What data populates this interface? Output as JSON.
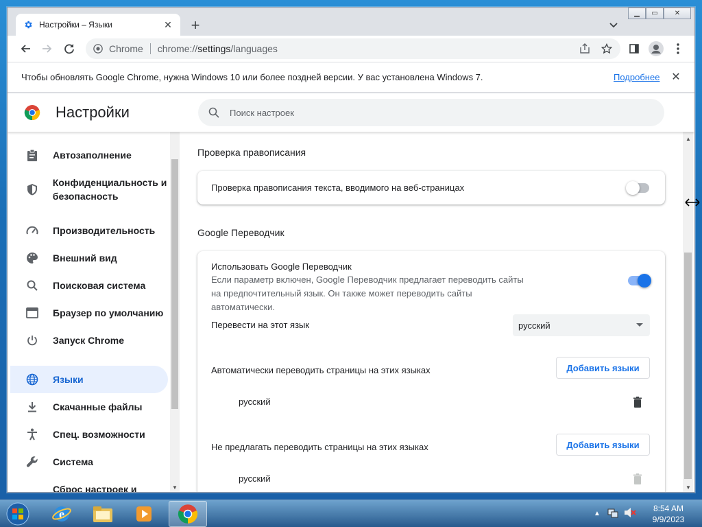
{
  "browser": {
    "tab_title": "Настройки – Языки",
    "omnibox_chip": "Chrome",
    "url_prefix": "chrome://",
    "url_host": "settings",
    "url_path": "/languages"
  },
  "infobar": {
    "message": "Чтобы обновлять Google Chrome, нужна Windows 10 или более поздней версии. У вас установлена Windows 7.",
    "link": "Подробнее"
  },
  "settings": {
    "title": "Настройки",
    "search_placeholder": "Поиск настроек"
  },
  "sidebar": {
    "items": [
      {
        "label": "Автозаполнение",
        "icon": "clipboard-icon"
      },
      {
        "label": "Конфиденциальность и безопасность",
        "icon": "shield-icon"
      },
      {
        "label": "Производительность",
        "icon": "speedometer-icon"
      },
      {
        "label": "Внешний вид",
        "icon": "palette-icon"
      },
      {
        "label": "Поисковая система",
        "icon": "search-icon"
      },
      {
        "label": "Браузер по умолчанию",
        "icon": "browser-icon"
      },
      {
        "label": "Запуск Chrome",
        "icon": "power-icon"
      },
      {
        "label": "Языки",
        "icon": "globe-icon",
        "active": true
      },
      {
        "label": "Скачанные файлы",
        "icon": "download-icon"
      },
      {
        "label": "Спец. возможности",
        "icon": "accessibility-icon"
      },
      {
        "label": "Система",
        "icon": "wrench-icon"
      },
      {
        "label": "Сброс настроек и",
        "icon": "reset-icon"
      }
    ]
  },
  "spellcheck": {
    "section_title": "Проверка правописания",
    "row_label": "Проверка правописания текста, вводимого на веб-страницах",
    "enabled": false
  },
  "translate": {
    "section_title": "Google Переводчик",
    "use_label": "Использовать Google Переводчик",
    "use_description": "Если параметр включен, Google Переводчик предлагает переводить сайты на предпочтительный язык. Он также может переводить сайты автоматически.",
    "use_enabled": true,
    "target_label": "Перевести на этот язык",
    "target_value": "русский",
    "auto_label": "Автоматически переводить страницы на этих языках",
    "auto_button": "Добавить языки",
    "auto_languages": [
      "русский"
    ],
    "never_label": "Не предлагать переводить страницы на этих языках",
    "never_button": "Добавить языки",
    "never_languages": [
      "русский"
    ]
  },
  "taskbar": {
    "time": "8:54 AM",
    "date": "9/9/2023"
  },
  "colors": {
    "accent": "#1a73e8",
    "active_nav_bg": "#e8f0fe",
    "active_nav_text": "#1967d2"
  }
}
